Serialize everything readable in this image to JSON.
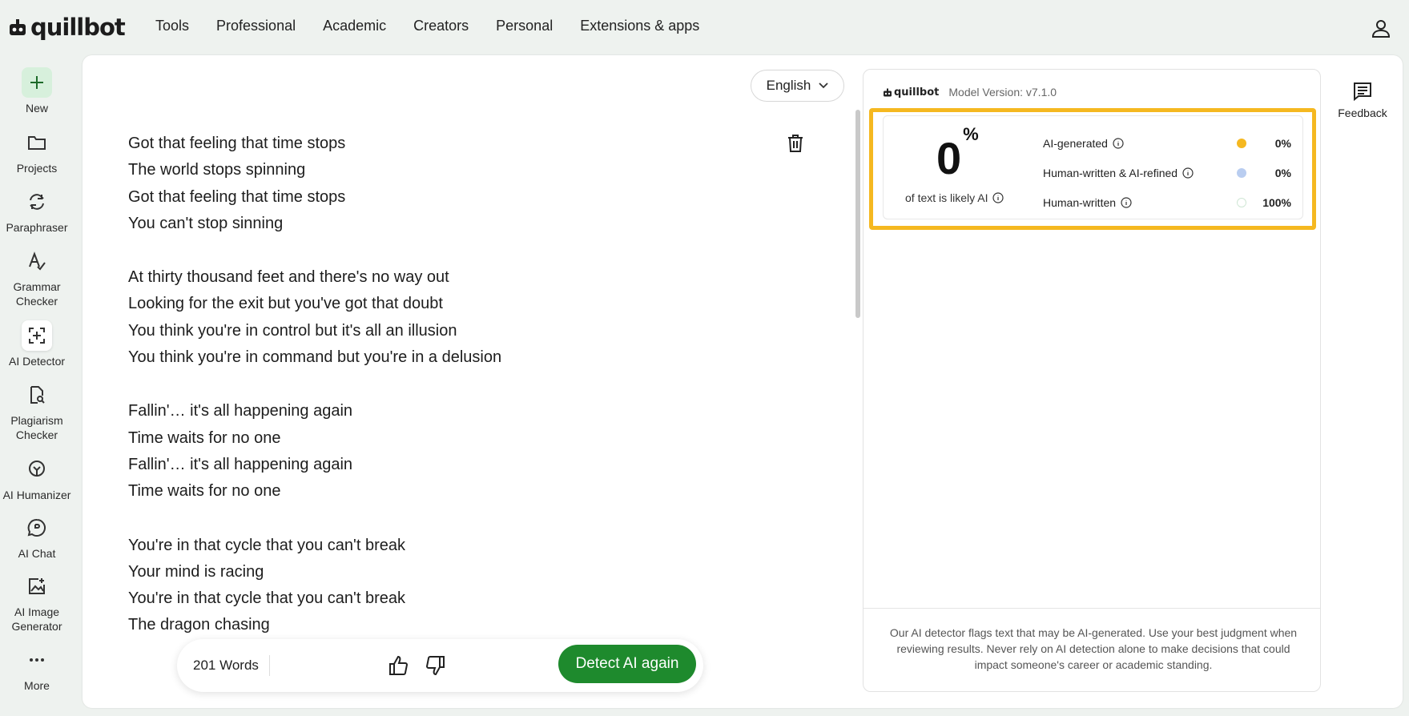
{
  "brand": {
    "name": "quillbot"
  },
  "nav": {
    "items": [
      "Tools",
      "Professional",
      "Academic",
      "Creators",
      "Personal",
      "Extensions & apps"
    ]
  },
  "sidebar": {
    "items": [
      {
        "label": "New",
        "icon": "plus-icon"
      },
      {
        "label": "Projects",
        "icon": "folder-icon"
      },
      {
        "label": "Paraphraser",
        "icon": "paraphraser-icon"
      },
      {
        "label": "Grammar Checker",
        "icon": "grammar-icon"
      },
      {
        "label": "AI Detector",
        "icon": "ai-detector-icon"
      },
      {
        "label": "Plagiarism Checker",
        "icon": "plagiarism-icon"
      },
      {
        "label": "AI Humanizer",
        "icon": "humanizer-icon"
      },
      {
        "label": "AI Chat",
        "icon": "chat-icon"
      },
      {
        "label": "AI Image Generator",
        "icon": "image-generator-icon"
      },
      {
        "label": "More",
        "icon": "more-icon"
      }
    ]
  },
  "editor": {
    "language": "English",
    "stanzas": [
      [
        "Got that feeling that time stops",
        "The world stops spinning",
        "Got that feeling that time stops",
        "You can't stop sinning"
      ],
      [
        "At thirty thousand feet and there's no way out",
        "Looking for the exit but you've got that doubt",
        "You think you're in control but it's all an illusion",
        "You think you're in command but you're in a delusion"
      ],
      [
        "Fallin'… it's all happening again",
        "Time waits for no one",
        "Fallin'… it's all happening again",
        "Time waits for no one"
      ],
      [
        "You're in that cycle that you can't break",
        "Your mind is racing",
        "You're in that cycle that you can't break",
        "The dragon chasing"
      ]
    ]
  },
  "bottom": {
    "word_count": "201 Words",
    "detect_label": "Detect AI again"
  },
  "result": {
    "brand": "quillbot",
    "model_version": "Model Version: v7.1.0",
    "score": "0",
    "score_unit": "%",
    "score_caption": "of text is likely AI",
    "stats": [
      {
        "label": "AI-generated",
        "value": "0%",
        "color": "#f5b820"
      },
      {
        "label": "Human-written & AI-refined",
        "value": "0%",
        "color": "#b9cdf0"
      },
      {
        "label": "Human-written",
        "value": "100%",
        "color": "#ffffff"
      }
    ],
    "disclaimer": "Our AI detector flags text that may be AI-generated. Use your best judgment when reviewing results. Never rely on AI detection alone to make decisions that could impact someone's career or academic standing."
  },
  "feedback": {
    "label": "Feedback"
  },
  "colors": {
    "accent": "#1e8a2d",
    "highlight": "#f5b820"
  }
}
